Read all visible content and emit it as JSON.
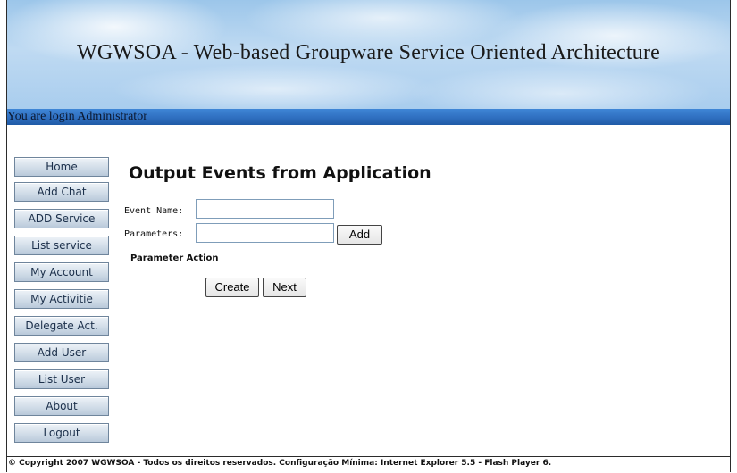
{
  "header": {
    "title": "WGWSOA - Web-based Groupware Service Oriented Architecture",
    "login_text": "You are login Administrator"
  },
  "nav": {
    "items": [
      {
        "label": "Home"
      },
      {
        "label": "Add Chat"
      },
      {
        "label": "ADD Service"
      },
      {
        "label": "List service"
      },
      {
        "label": "My Account"
      },
      {
        "label": "My Activitie"
      },
      {
        "label": "Delegate Act."
      },
      {
        "label": "Add User"
      },
      {
        "label": "List User"
      },
      {
        "label": "About"
      },
      {
        "label": "Logout"
      }
    ]
  },
  "main": {
    "title": "Output Events from Application",
    "event_name_label": "Event Name:",
    "event_name_value": "",
    "parameters_label": "Parameters:",
    "parameters_value": "",
    "add_button": "Add",
    "parameter_action_label": "Parameter Action",
    "create_button": "Create",
    "next_button": "Next"
  },
  "footer": {
    "text": "© Copyright 2007 WGWSOA - Todos os direitos reservados. Configuração Mínima: Internet Explorer 5.5 - Flash Player 6."
  },
  "colors": {
    "banner_sky": "#a9cdee",
    "login_bar": "#2f6fc0",
    "nav_button": "#cfdbe7"
  }
}
